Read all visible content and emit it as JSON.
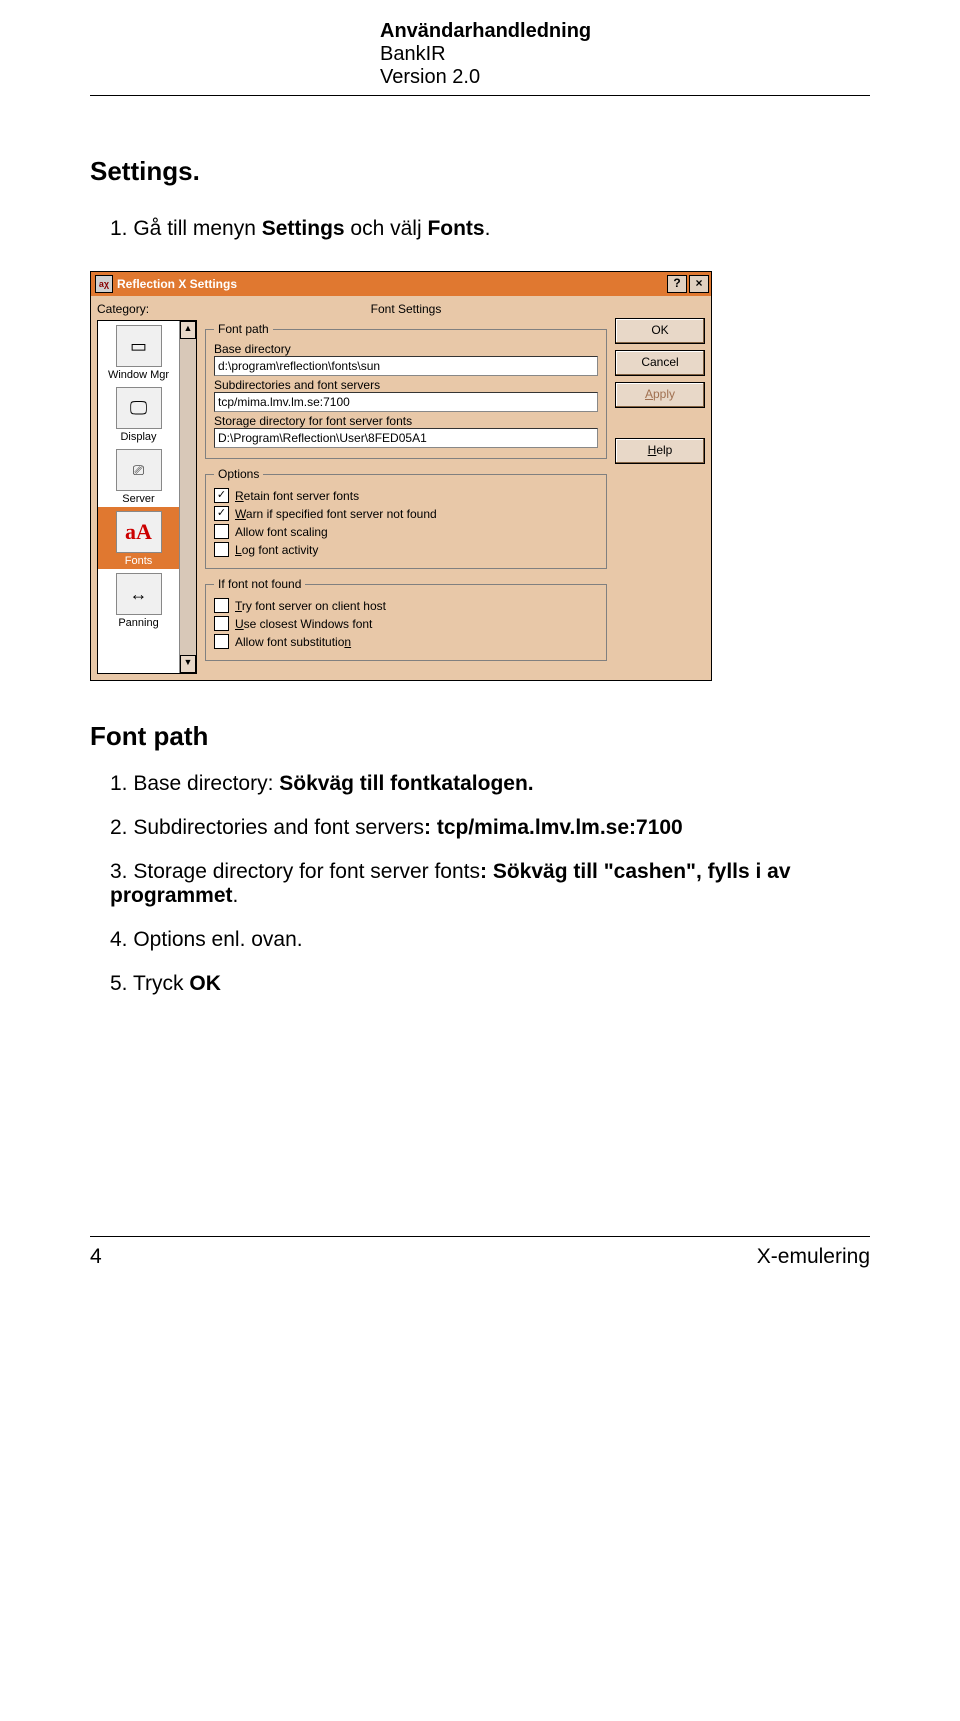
{
  "header": {
    "title_bold": "Användarhandledning",
    "line2": "BankIR",
    "line3": "Version 2.0"
  },
  "section": {
    "heading": "Settings.",
    "step1_prefix": "1.  Gå till menyn ",
    "step1_bold1": "Settings",
    "step1_mid": " och välj ",
    "step1_bold2": "Fonts",
    "step1_suffix": "."
  },
  "dialog": {
    "title": "Reflection X Settings",
    "category_label": "Category:",
    "panel_title": "Font Settings",
    "categories": {
      "window_mgr": "Window Mgr",
      "display": "Display",
      "server": "Server",
      "fonts": "Fonts",
      "panning": "Panning"
    },
    "font_path": {
      "legend": "Font path",
      "base_dir_label": "Base directory",
      "base_dir_value": "d:\\program\\reflection\\fonts\\sun",
      "subdirs_label": "Subdirectories and font servers",
      "subdirs_value": "tcp/mima.lmv.lm.se:7100",
      "storage_label": "Storage directory for font server fonts",
      "storage_value": "D:\\Program\\Reflection\\User\\8FED05A1"
    },
    "options": {
      "legend": "Options",
      "retain_pre": "R",
      "retain_post": "etain font server fonts",
      "warn_pre": "W",
      "warn_post": "arn if specified font server not found",
      "allow": "Allow font scaling",
      "log_pre": "L",
      "log_post": "og font activity"
    },
    "notfound": {
      "legend": "If font not found",
      "try_pre": "T",
      "try_post": "ry font server on client host",
      "use_pre": "U",
      "use_post": "se closest Windows font",
      "allow_pre": "Allow font substitutio",
      "allow_post": "n"
    },
    "buttons": {
      "ok": "OK",
      "cancel": "Cancel",
      "apply_pre": "A",
      "apply_post": "pply",
      "help_pre": "H",
      "help_post": "elp"
    }
  },
  "fontpath": {
    "heading": "Font path",
    "s1_pre": "1.  Base directory: ",
    "s1_bold": "Sökväg till fontkatalogen.",
    "s2_pre": "2.  Subdirectories and font servers",
    "s2_bold": ": tcp/mima.lmv.lm.se:7100",
    "s3_pre": "3.  Storage directory for font server fonts",
    "s3_bold": ": Sökväg till \"cashen\", fylls i av programmet",
    "s3_suffix": ".",
    "s4": "4.  Options enl. ovan.",
    "s5_pre": "5.  Tryck ",
    "s5_bold": "OK"
  },
  "footer": {
    "page": "4",
    "section": "X-emulering"
  }
}
